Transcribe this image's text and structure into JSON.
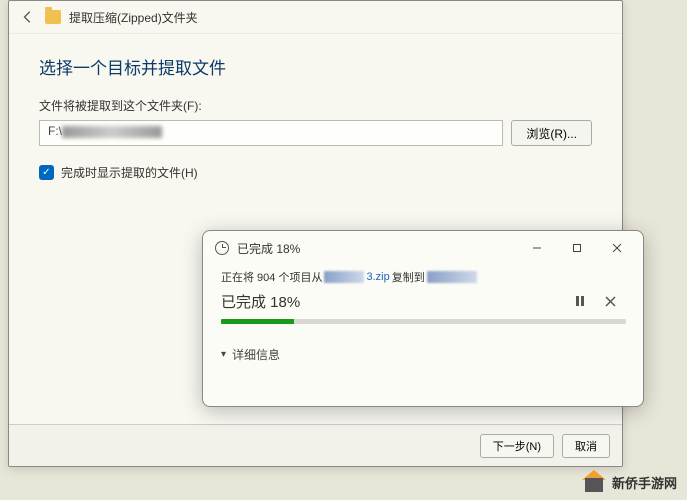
{
  "main": {
    "title": "提取压缩(Zipped)文件夹",
    "heading": "选择一个目标并提取文件",
    "path_label": "文件将被提取到这个文件夹(F):",
    "path_value": "F:\\",
    "browse_label": "浏览(R)...",
    "checkbox_label": "完成时显示提取的文件(H)",
    "checkbox_checked": true,
    "footer": {
      "next": "下一步(N)",
      "cancel": "取消"
    }
  },
  "progress": {
    "title": "已完成 18%",
    "item_prefix": "正在将 904 个项目从",
    "item_source": "3.zip",
    "item_action": "复制到",
    "status": "已完成 18%",
    "percent": 18,
    "details_label": "详细信息"
  },
  "watermark": "新侨手游网"
}
